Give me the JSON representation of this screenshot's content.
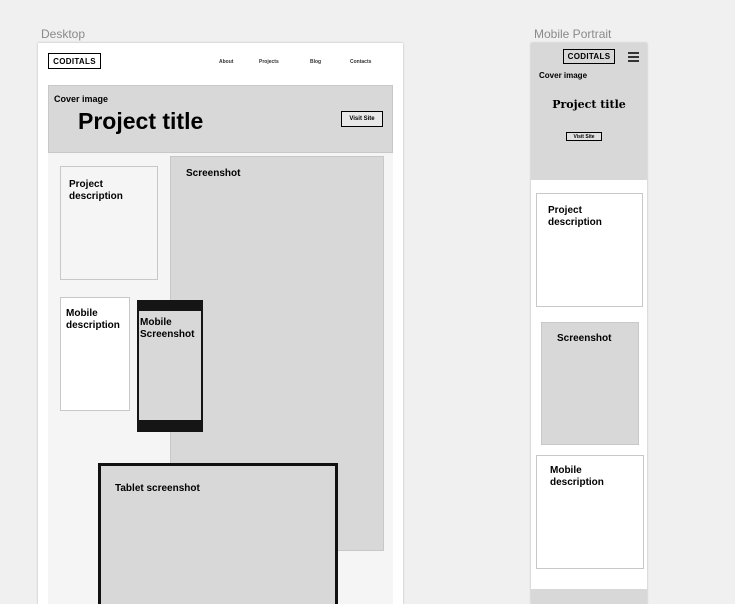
{
  "artboards": {
    "desktop_label": "Desktop",
    "mobile_label": "Mobile Portrait"
  },
  "desktop": {
    "logo": "CODITALS",
    "nav": [
      "About",
      "Projects",
      "Blog",
      "Contacts"
    ],
    "cover_label": "Cover image",
    "project_title": "Project title",
    "visit_site": "Visit Site",
    "screenshot_label": "Screenshot",
    "project_description": "Project description",
    "mobile_description": "Mobile description",
    "mobile_screenshot": "Mobile Screenshot",
    "tablet_screenshot": "Tablet screenshot"
  },
  "mobile": {
    "logo": "CODITALS",
    "menu_icon": "hamburger-icon",
    "cover_label": "Cover image",
    "project_title": "Project title",
    "visit_site": "Visit Site",
    "project_description": "Project description",
    "screenshot_label": "Screenshot",
    "mobile_description": "Mobile description"
  }
}
